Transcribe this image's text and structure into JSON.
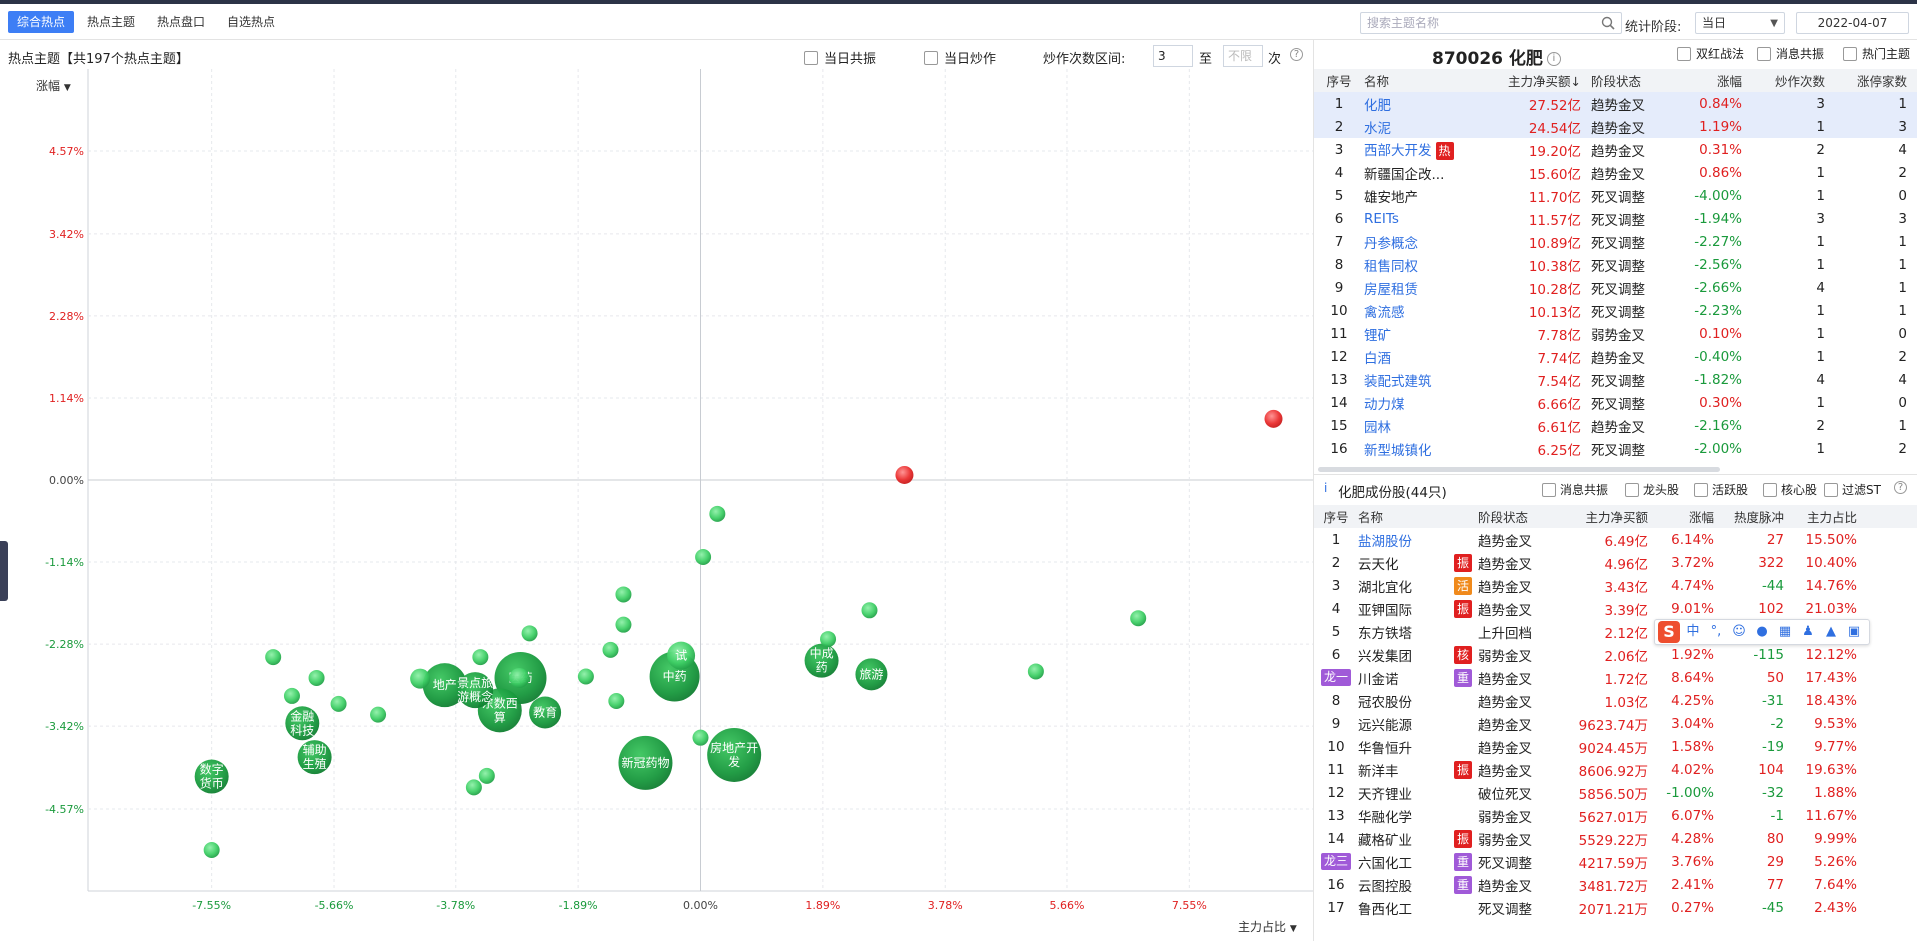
{
  "top_tabs": [
    "综合热点",
    "热点主题",
    "热点盘口",
    "自选热点"
  ],
  "search": {
    "placeholder": "搜索主题名称"
  },
  "stat_period": {
    "label": "统计阶段:",
    "value": "当日",
    "date": "2022-04-07"
  },
  "left": {
    "title": "热点主题【共197个热点主题】",
    "opt_resonance": "当日共振",
    "opt_hype": "当日炒作",
    "range_label": "炒作次数区间:",
    "range_from": "3",
    "range_to_label": "至",
    "range_to_placeholder": "不限",
    "range_unit": "次",
    "help": "?"
  },
  "chart_data": {
    "type": "scatter",
    "ylabel": "涨幅",
    "xlabel": "主力占比",
    "y_ticks": [
      "4.57%",
      "3.42%",
      "2.28%",
      "1.14%",
      "0.00%",
      "-1.14%",
      "-2.28%",
      "-3.42%",
      "-4.57%"
    ],
    "y_tick_values": [
      4.57,
      3.42,
      2.28,
      1.14,
      0,
      -1.14,
      -2.28,
      -3.42,
      -4.57
    ],
    "x_ticks": [
      "-7.55%",
      "-5.66%",
      "-3.78%",
      "-1.89%",
      "0.00%",
      "1.89%",
      "3.78%",
      "5.66%",
      "7.55%"
    ],
    "x_tick_values": [
      -7.55,
      -5.66,
      -3.78,
      -1.89,
      0,
      1.89,
      3.78,
      5.66,
      7.55
    ],
    "xlim": [
      -9.46,
      9.46
    ],
    "ylim": [
      -5.71,
      5.71
    ],
    "grid": true,
    "points": [
      {
        "x": 8.85,
        "y": 0.85,
        "r": 9,
        "label": "",
        "color": "red"
      },
      {
        "x": 3.15,
        "y": 0.07,
        "r": 9,
        "label": "",
        "color": "red"
      },
      {
        "x": 0.26,
        "y": -0.47,
        "r": 8,
        "label": ""
      },
      {
        "x": 0.04,
        "y": -1.07,
        "r": 8,
        "label": ""
      },
      {
        "x": -1.19,
        "y": -1.59,
        "r": 8,
        "label": ""
      },
      {
        "x": -1.19,
        "y": -2.01,
        "r": 8,
        "label": ""
      },
      {
        "x": -1.39,
        "y": -2.36,
        "r": 8,
        "label": ""
      },
      {
        "x": -1.77,
        "y": -2.73,
        "r": 8,
        "label": ""
      },
      {
        "x": -2.64,
        "y": -2.13,
        "r": 8,
        "label": ""
      },
      {
        "x": -3.4,
        "y": -2.46,
        "r": 8,
        "label": ""
      },
      {
        "x": -4.98,
        "y": -3.26,
        "r": 8,
        "label": ""
      },
      {
        "x": -5.59,
        "y": -3.11,
        "r": 8,
        "label": ""
      },
      {
        "x": -5.93,
        "y": -2.75,
        "r": 8,
        "label": ""
      },
      {
        "x": -6.31,
        "y": -3.0,
        "r": 8,
        "label": ""
      },
      {
        "x": -6.6,
        "y": -2.46,
        "r": 8,
        "label": ""
      },
      {
        "x": -7.55,
        "y": -5.14,
        "r": 8,
        "label": ""
      },
      {
        "x": -1.3,
        "y": -3.07,
        "r": 8,
        "label": ""
      },
      {
        "x": -3.3,
        "y": -4.11,
        "r": 8,
        "label": ""
      },
      {
        "x": -3.5,
        "y": -4.27,
        "r": 8,
        "label": ""
      },
      {
        "x": 0.0,
        "y": -3.58,
        "r": 8,
        "label": ""
      },
      {
        "x": 1.97,
        "y": -2.21,
        "r": 8,
        "label": ""
      },
      {
        "x": 2.61,
        "y": -1.81,
        "r": 8,
        "label": ""
      },
      {
        "x": 5.18,
        "y": -2.66,
        "r": 8,
        "label": ""
      },
      {
        "x": 6.76,
        "y": -1.92,
        "r": 8,
        "label": ""
      },
      {
        "x": -4.33,
        "y": -2.76,
        "r": 10,
        "label": ""
      },
      {
        "x": -3.95,
        "y": -2.85,
        "r": 22,
        "label": "地产"
      },
      {
        "x": -3.48,
        "y": -2.92,
        "r": 18,
        "label": "景点旅游概念"
      },
      {
        "x": -3.1,
        "y": -3.2,
        "r": 22,
        "label": "东数西算"
      },
      {
        "x": -2.8,
        "y": -2.75,
        "r": 10,
        "label": ""
      },
      {
        "x": -2.78,
        "y": -2.75,
        "r": 26,
        "label": "医药"
      },
      {
        "x": -2.4,
        "y": -3.23,
        "r": 16,
        "label": "教育"
      },
      {
        "x": -0.4,
        "y": -2.73,
        "r": 25,
        "label": "中药"
      },
      {
        "x": -0.3,
        "y": -2.44,
        "r": 14,
        "label": "试"
      },
      {
        "x": -0.85,
        "y": -3.93,
        "r": 27,
        "label": "新冠药物"
      },
      {
        "x": 0.52,
        "y": -3.82,
        "r": 27,
        "label": "房地产开发"
      },
      {
        "x": 1.87,
        "y": -2.51,
        "r": 17,
        "label": "中成药"
      },
      {
        "x": 2.64,
        "y": -2.7,
        "r": 16,
        "label": "旅游"
      },
      {
        "x": -6.15,
        "y": -3.38,
        "r": 17,
        "label": "金融科技"
      },
      {
        "x": -5.96,
        "y": -3.85,
        "r": 17,
        "label": "辅助生殖"
      },
      {
        "x": -7.55,
        "y": -4.12,
        "r": 17,
        "label": "数字货币"
      }
    ]
  },
  "right_top": {
    "title": "870026 化肥",
    "info": "i",
    "options": [
      "双红战法",
      "消息共振",
      "热门主题"
    ],
    "headers": [
      "序号",
      "名称",
      "主力净买额↓",
      "阶段状态",
      "涨幅",
      "炒作次数",
      "涨停家数"
    ],
    "rows": [
      [
        "1",
        "化肥",
        "27.52亿",
        "趋势金叉",
        "0.84%",
        "3",
        "1"
      ],
      [
        "2",
        "水泥",
        "24.54亿",
        "趋势金叉",
        "1.19%",
        "1",
        "3"
      ],
      [
        "3",
        "西部大开发",
        "19.20亿",
        "趋势金叉",
        "0.31%",
        "2",
        "4"
      ],
      [
        "4",
        "新疆国企改...",
        "15.60亿",
        "趋势金叉",
        "0.86%",
        "1",
        "2"
      ],
      [
        "5",
        "雄安地产",
        "11.70亿",
        "死叉调整",
        "-4.00%",
        "1",
        "0"
      ],
      [
        "6",
        "REITs",
        "11.57亿",
        "死叉调整",
        "-1.94%",
        "3",
        "3"
      ],
      [
        "7",
        "丹参概念",
        "10.89亿",
        "死叉调整",
        "-2.27%",
        "1",
        "1"
      ],
      [
        "8",
        "租售同权",
        "10.38亿",
        "死叉调整",
        "-2.56%",
        "1",
        "1"
      ],
      [
        "9",
        "房屋租赁",
        "10.28亿",
        "死叉调整",
        "-2.66%",
        "4",
        "1"
      ],
      [
        "10",
        "禽流感",
        "10.13亿",
        "死叉调整",
        "-2.23%",
        "1",
        "1"
      ],
      [
        "11",
        "锂矿",
        "7.78亿",
        "弱势金叉",
        "0.10%",
        "1",
        "0"
      ],
      [
        "12",
        "白酒",
        "7.74亿",
        "趋势金叉",
        "-0.40%",
        "1",
        "2"
      ],
      [
        "13",
        "装配式建筑",
        "7.54亿",
        "死叉调整",
        "-1.82%",
        "4",
        "4"
      ],
      [
        "14",
        "动力煤",
        "6.66亿",
        "死叉调整",
        "0.30%",
        "1",
        "0"
      ],
      [
        "15",
        "园林",
        "6.61亿",
        "趋势金叉",
        "-2.16%",
        "2",
        "1"
      ],
      [
        "16",
        "新型城镇化",
        "6.25亿",
        "死叉调整",
        "-2.00%",
        "1",
        "2"
      ]
    ],
    "hot_tag": "热"
  },
  "right_bottom": {
    "info": "i",
    "title": "化肥成份股(44只)",
    "options": [
      "消息共振",
      "龙头股",
      "活跃股",
      "核心股",
      "过滤ST"
    ],
    "help": "?",
    "headers": [
      "序号",
      "名称",
      "阶段状态",
      "主力净买额",
      "涨幅",
      "热度脉冲",
      "主力占比"
    ],
    "rows": [
      {
        "idx": "1",
        "name": "盐湖股份",
        "tag": "",
        "state": "趋势金叉",
        "amount": "6.49亿",
        "change": "6.14%",
        "heat": "27",
        "ratio": "15.50%"
      },
      {
        "idx": "2",
        "name": "云天化",
        "tag": "振",
        "state": "趋势金叉",
        "amount": "4.96亿",
        "change": "3.72%",
        "heat": "322",
        "ratio": "10.40%"
      },
      {
        "idx": "3",
        "name": "湖北宜化",
        "tag": "活",
        "state": "趋势金叉",
        "amount": "3.43亿",
        "change": "4.74%",
        "heat": "-44",
        "ratio": "14.76%"
      },
      {
        "idx": "4",
        "name": "亚钾国际",
        "tag": "振",
        "state": "趋势金叉",
        "amount": "3.39亿",
        "change": "9.01%",
        "heat": "102",
        "ratio": "21.03%"
      },
      {
        "idx": "5",
        "name": "东方铁塔",
        "tag": "",
        "state": "上升回档",
        "amount": "2.12亿",
        "change": "",
        "heat": "",
        "ratio": ""
      },
      {
        "idx": "6",
        "name": "兴发集团",
        "tag": "核",
        "state": "弱势金叉",
        "amount": "2.06亿",
        "change": "1.92%",
        "heat": "-115",
        "ratio": "12.12%"
      },
      {
        "idx": "龙一",
        "name": "川金诺",
        "tag": "重",
        "state": "趋势金叉",
        "amount": "1.72亿",
        "change": "8.64%",
        "heat": "50",
        "ratio": "17.43%"
      },
      {
        "idx": "8",
        "name": "冠农股份",
        "tag": "",
        "state": "趋势金叉",
        "amount": "1.03亿",
        "change": "4.25%",
        "heat": "-31",
        "ratio": "18.43%"
      },
      {
        "idx": "9",
        "name": "远兴能源",
        "tag": "",
        "state": "趋势金叉",
        "amount": "9623.74万",
        "change": "3.04%",
        "heat": "-2",
        "ratio": "9.53%"
      },
      {
        "idx": "10",
        "name": "华鲁恒升",
        "tag": "",
        "state": "趋势金叉",
        "amount": "9024.45万",
        "change": "1.58%",
        "heat": "-19",
        "ratio": "9.77%"
      },
      {
        "idx": "11",
        "name": "新洋丰",
        "tag": "振",
        "state": "趋势金叉",
        "amount": "8606.92万",
        "change": "4.02%",
        "heat": "104",
        "ratio": "19.63%"
      },
      {
        "idx": "12",
        "name": "天齐锂业",
        "tag": "",
        "state": "破位死叉",
        "amount": "5856.50万",
        "change": "-1.00%",
        "heat": "-32",
        "ratio": "1.88%"
      },
      {
        "idx": "13",
        "name": "华融化学",
        "tag": "",
        "state": "弱势金叉",
        "amount": "5627.01万",
        "change": "6.07%",
        "heat": "-1",
        "ratio": "11.67%"
      },
      {
        "idx": "14",
        "name": "藏格矿业",
        "tag": "振",
        "state": "弱势金叉",
        "amount": "5529.22万",
        "change": "4.28%",
        "heat": "80",
        "ratio": "9.99%"
      },
      {
        "idx": "龙三",
        "name": "六国化工",
        "tag": "重",
        "state": "死叉调整",
        "amount": "4217.59万",
        "change": "3.76%",
        "heat": "29",
        "ratio": "5.26%"
      },
      {
        "idx": "16",
        "name": "云图控股",
        "tag": "重",
        "state": "趋势金叉",
        "amount": "3481.72万",
        "change": "2.41%",
        "heat": "77",
        "ratio": "7.64%"
      },
      {
        "idx": "17",
        "name": "鲁西化工",
        "tag": "",
        "state": "死叉调整",
        "amount": "2071.21万",
        "change": "0.27%",
        "heat": "-45",
        "ratio": "2.43%"
      }
    ]
  },
  "ime": {
    "logo": "S",
    "mode": "中",
    "punct": "°,"
  },
  "colors": {
    "accent": "#3d7ef5",
    "up": "#e02020",
    "down": "#1a9a3c",
    "link": "#2f6fe0",
    "tag_red": "#e02020",
    "tag_orange": "#f08a1c",
    "tag_purple": "#a05ad8"
  }
}
